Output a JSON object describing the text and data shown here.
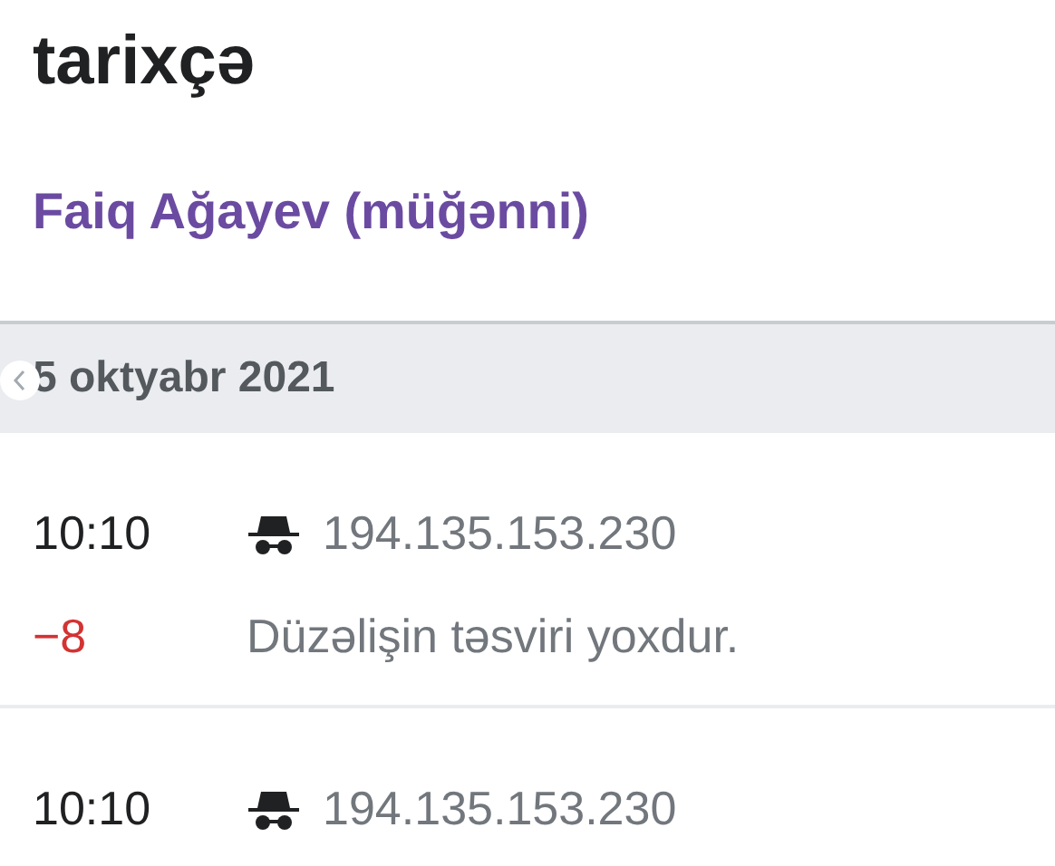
{
  "page": {
    "title": "tarixçə",
    "subtitle": "Faiq Ağayev (müğənni)"
  },
  "date_header": "5 oktyabr 2021",
  "entries": [
    {
      "time": "10:10",
      "user": "194.135.153.230",
      "anonymous": true,
      "change": {
        "text": "−8",
        "color": "#d33333"
      },
      "summary": "Düzəlişin təsviri yoxdur."
    },
    {
      "time": "10:10",
      "user": "194.135.153.230",
      "anonymous": true
    }
  ]
}
